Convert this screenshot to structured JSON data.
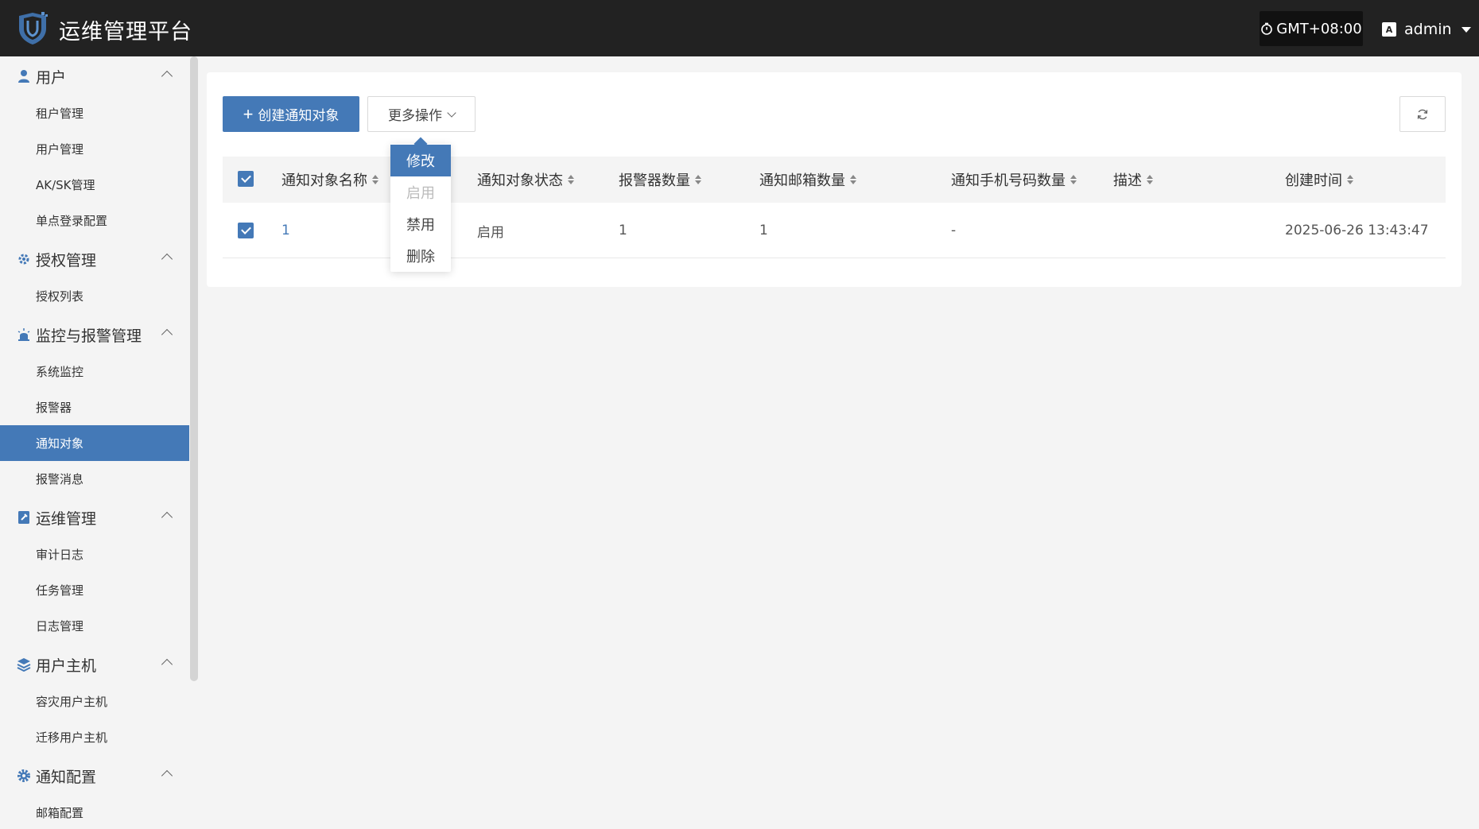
{
  "header": {
    "title": "运维管理平台",
    "timezone": "GMT+08:00",
    "user": "admin",
    "user_icon_text": "A"
  },
  "sidebar": {
    "groups": [
      {
        "label": "用户",
        "icon": "user-icon",
        "items": [
          "租户管理",
          "用户管理",
          "AK/SK管理",
          "单点登录配置"
        ]
      },
      {
        "label": "授权管理",
        "icon": "key-gear-icon",
        "items": [
          "授权列表"
        ]
      },
      {
        "label": "监控与报警管理",
        "icon": "alarm-icon",
        "items": [
          "系统监控",
          "报警器",
          "通知对象",
          "报警消息"
        ]
      },
      {
        "label": "运维管理",
        "icon": "ops-icon",
        "items": [
          "审计日志",
          "任务管理",
          "日志管理"
        ]
      },
      {
        "label": "用户主机",
        "icon": "layers-icon",
        "items": [
          "容灾用户主机",
          "迁移用户主机"
        ]
      },
      {
        "label": "通知配置",
        "icon": "gear-icon",
        "items": [
          "邮箱配置"
        ]
      }
    ],
    "active_item": "通知对象"
  },
  "toolbar": {
    "create_label": "创建通知对象",
    "more_label": "更多操作"
  },
  "dropdown": {
    "items": [
      {
        "label": "修改",
        "state": "active"
      },
      {
        "label": "启用",
        "state": "disabled"
      },
      {
        "label": "禁用",
        "state": "normal"
      },
      {
        "label": "删除",
        "state": "normal"
      }
    ]
  },
  "table": {
    "columns": [
      "通知对象名称",
      "通知对象状态",
      "报警器数量",
      "通知邮箱数量",
      "通知手机号码数量",
      "描述",
      "创建时间"
    ],
    "rows": [
      {
        "name": "1",
        "status": "启用",
        "alarm_count": "1",
        "email_count": "1",
        "phone_count": "-",
        "description": "",
        "created": "2025-06-26 13:43:47"
      }
    ]
  },
  "colors": {
    "accent": "#4479b7",
    "header_bg": "#222222",
    "page_bg": "#f4f4f4"
  }
}
